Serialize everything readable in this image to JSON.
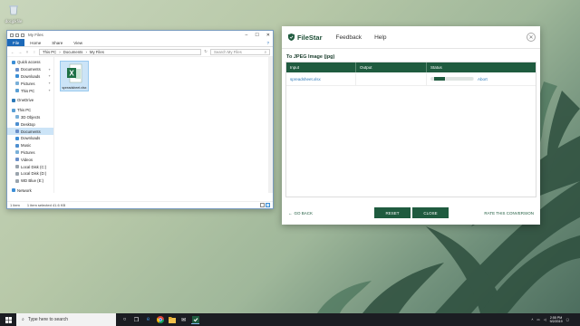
{
  "desktop": {
    "icon_label": "docjpkfile"
  },
  "explorer": {
    "title": "My Files",
    "window_controls": [
      "–",
      "☐",
      "✕"
    ],
    "tabs": [
      "File",
      "Home",
      "Share",
      "View"
    ],
    "breadcrumb": [
      "This PC",
      "Documents",
      "My Files"
    ],
    "search_placeholder": "Search My Files",
    "sidebar": [
      {
        "label": "Quick access",
        "level": 0,
        "color": "#3c8ed6",
        "pinned": false
      },
      {
        "label": "Documents",
        "level": 1,
        "color": "#6a8fc9",
        "pinned": true
      },
      {
        "label": "Downloads",
        "level": 1,
        "color": "#3c8ed6",
        "pinned": true
      },
      {
        "label": "Pictures",
        "level": 1,
        "color": "#7ab0d8",
        "pinned": true
      },
      {
        "label": "This PC",
        "level": 1,
        "color": "#5a9fd4",
        "pinned": true
      },
      {
        "label": "",
        "level": -1
      },
      {
        "label": "OneDrive",
        "level": 0,
        "color": "#2b79b8",
        "pinned": false
      },
      {
        "label": "",
        "level": -1
      },
      {
        "label": "This PC",
        "level": 0,
        "color": "#5a9fd4",
        "pinned": false
      },
      {
        "label": "3D Objects",
        "level": 1,
        "color": "#7ab0d8",
        "pinned": false
      },
      {
        "label": "Desktop",
        "level": 1,
        "color": "#4d8fd0",
        "pinned": false
      },
      {
        "label": "Documents",
        "level": 1,
        "color": "#6a8fc9",
        "pinned": false,
        "selected": true
      },
      {
        "label": "Downloads",
        "level": 1,
        "color": "#3c8ed6",
        "pinned": false
      },
      {
        "label": "Music",
        "level": 1,
        "color": "#4d8fd0",
        "pinned": false
      },
      {
        "label": "Pictures",
        "level": 1,
        "color": "#7ab0d8",
        "pinned": false
      },
      {
        "label": "Videos",
        "level": 1,
        "color": "#6a8fc9",
        "pinned": false
      },
      {
        "label": "Local Disk (C:)",
        "level": 1,
        "color": "#9aa4ad",
        "pinned": false
      },
      {
        "label": "Local Disk (D:)",
        "level": 1,
        "color": "#9aa4ad",
        "pinned": false
      },
      {
        "label": "WD Blue (E:)",
        "level": 1,
        "color": "#9aa4ad",
        "pinned": false
      },
      {
        "label": "",
        "level": -1
      },
      {
        "label": "Network",
        "level": 0,
        "color": "#3c8ed6",
        "pinned": false
      }
    ],
    "file": {
      "name": "spreadsheet.xlsx",
      "icon": "excel-file-icon"
    },
    "status_items": "1 item",
    "status_selected": "1 item selected  41.6 KB"
  },
  "filestar": {
    "logo_text": "FileStar",
    "nav": [
      "Feedback",
      "Help"
    ],
    "conversion_title": "To JPEG Image (jpg)",
    "columns": [
      "Input",
      "Output",
      "Status"
    ],
    "rows": [
      {
        "input": "spreadsheet.xlsx",
        "output": "",
        "progress": 0.3,
        "action": "Abort"
      }
    ],
    "go_back": "GO BACK",
    "reset": "RESET",
    "close": "CLOSE",
    "rate": "RATE THIS CONVERSION",
    "accent": "#1f5b3f"
  },
  "taskbar": {
    "search_placeholder": "Type here to search",
    "time": "2:55 PM",
    "date": "9/2/2019"
  }
}
